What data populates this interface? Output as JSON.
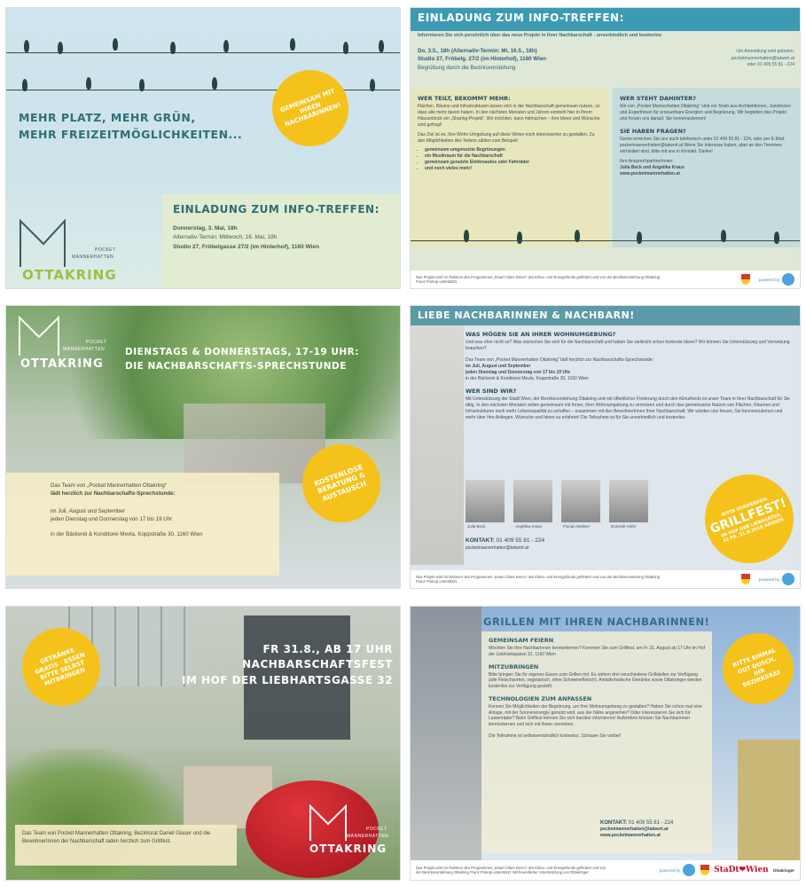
{
  "panel1": {
    "headline_1": "MEHR PLATZ, MEHR GRÜN,",
    "headline_2": "MEHR FREIZEITMÖGLICHKEITEN...",
    "badge": "GEMEINSAM MIT IHREN NACHBARINNEN!",
    "invite_title": "EINLADUNG ZUM INFO-TREFFEN:",
    "line_1": "Donnerstag, 3. Mai, 18h",
    "line_2": "Alternativ-Termin: Mittwoch, 16. Mai, 18h",
    "line_3": "Studio 27, Fröbelgasse 27/2 (im Hinterhof), 1160 Wien",
    "logo_pocket": "POCKET",
    "logo_mannerhatten": "MANNERHATTEN",
    "logo_ottakring": "OTTAKRING"
  },
  "panel2": {
    "title": "EINLADUNG ZUM INFO-TREFFEN:",
    "subtitle": "Informieren Sie sich persönlich über das neue Projekt in Ihrer Nachbarschaft - unverbindlich und kostenlos",
    "date": "Do, 3.5., 18h (Alternativ-Termin: Mi, 16.5., 18h)",
    "place": "Studio 27, Fröbelg. 27/2 (im Hinterhof), 1160 Wien",
    "greeting": "Begrüßung durch die Bezirksvorstehung",
    "contact_right_1": "Um Anmeldung wird gebeten:",
    "contact_right_2": "pocketmannerhatten@tatwort.at",
    "contact_right_3": "oder 01 409 55 81 - 224",
    "col1_title": "WER TEILT, BEKOMMT MEHR:",
    "col1_body": "Flächen, Räume und Infrastrukturen lassen sich in der Nachbarschaft gemeinsam nutzen, so dass alle mehr davon haben. In den nächsten Monaten und Jahren entsteht hier in Ihrem Häuserblock ein „Sharing-Projekt“. Wir möchten, kann mitmachen – Ihre Ideen und Wünsche sind gefragt!",
    "col1_body_2": "Das Ziel ist es, Ihre Wohn-Umgebung auf diese Weise noch lebenswerter zu gestalten. Zu den Möglichkeiten des Teilens zählen zum Beispiel:",
    "col1_list": [
      "gemeinsam umgenutzte Begrünungen",
      "ein Musikraum für die Nachbarschaft",
      "gemeinsam genutzte Elektroautos oder Fahrräder",
      "und noch vieles mehr!"
    ],
    "col2_title": "WER STEHT DAHINTER?",
    "col2_body": "Wir von „Pocket Mannerhatten Ottakring“ sind ein Team aus ArchitektInnen, JuristInnen und ExpertInnen für erneuerbare Energien und Begrünung. Wir begleiten das Projekt und freuen uns darauf, Sie kennenzulernen!",
    "col3_title": "SIE HABEN FRAGEN?",
    "col3_body": "Gerne erreichen Sie uns auch telefonisch unter 01 409 55 81 - 224, oder per E-Mail: pocketmannerhatten@tatwort.at Wenn Sie Interesse haben, aber an den Terminen verhindert sind, bitte mit uns in Kontakt. Danke!",
    "col3_contact_1": "Ihre AnsprechpartnerInnen:",
    "col3_contact_2": "Julia Beck und Angelika Kraus",
    "col3_contact_3": "www.pocketmannerhatten.at",
    "footer": "Das Projekt wird im Rahmen des Programmes „Smart Cities Demo“ des Klima- und Energiefonds gefördert und von der Bezirksvorstehung Ottakring Franz Prokop unterstützt.",
    "powered": "powered by"
  },
  "panel3": {
    "headline_1": "DIENSTAGS & DONNERSTAGS, 17-19 UHR:",
    "headline_2": "DIE NACHBARSCHAFTS-SPRECHSTUNDE",
    "badge": "KOSTENLOSE BERATUNG & AUSTAUSCH",
    "body_1": "Das Team von „Pocket Mannerhatten Ottakring“",
    "body_2": "lädt herzlich zur Nachbarschafts-Sprechstunde:",
    "body_3": "im Juli, August und September",
    "body_4": "jeden Dienstag und Donnerstag von 17 bis 19 Uhr",
    "body_5": "in der Bäckerei & Konditorei Mevla, Koppstraße 30, 1160 Wien",
    "logo_pocket": "POCKET",
    "logo_mannerhatten": "MANNERHATTEN",
    "logo_ottakring": "OTTAKRING"
  },
  "panel4": {
    "title": "LIEBE NACHBARINNEN & NACHBARN!",
    "q1": "WAS MÖGEN SIE AN IHRER WOHNUMGEBUNG?",
    "q1_body": "Und was eher nicht so? Was wünschen Sie sich für die Nachbarschaft und haben Sie vielleicht schon konkrete Ideen? Wir können Sie Unterstützung und Vernetzung brauchen?",
    "mid_1": "Das Team von „Pocket Mannerhatten Ottakring“ lädt herzlich zur Nachbarschafts-Sprechstunde:",
    "mid_2": "im Juli, August und September",
    "mid_3": "jeden Dienstag und Donnerstag von 17 bis 19 Uhr",
    "mid_4": "in der Bäckerei & Konditorei Mevla, Koppstraße 30, 1160 Wien",
    "q2": "WER SIND WIR?",
    "q2_body": "Mit Unterstützung der Stadt Wien, der Bezirksvorstehung Ottakring und mit öffentlicher Förderung durch den Klimafonds ist unser Team in Ihrer Nachbarschaft für Sie tätig. In den nächsten Monaten sollen gemeinsam mit Ihnen, Ihrer Wohnumgebung zu vernetzen und durch das gemeinsame Nutzen von Flächen, Räumen und Infrastrukturen noch mehr Lebensqualität zu schaffen – zusammen mit den BewohnerInnen Ihrer Nachbarschaft. Wir würden uns freuen, Sie kennenzulernen und mehr über Ihre Anliegen, Wünsche und Ideen zu erfahren! Die Teilnahme ist für Sie unverbindlich und kostenlos.",
    "names": [
      "Julia Beck",
      "Angelika Kraus",
      "Florian Wallner",
      "Dominik Hofer"
    ],
    "kontakt_label": "KONTAKT:",
    "kontakt_phone": "01 409 55 81 - 224",
    "kontakt_mail": "pocketmannerhatten@tatwort.at",
    "badge_top": "BITTE VORMERKEN:",
    "badge_main": "GRILLFEST!",
    "badge_bottom": "IM HOF DER LIEBHARTSG. 32 FR. 31.8.2018 ABENDS",
    "footer": "Das Projekt wird im Rahmen des Programmes „Smart Cities Demo“ des Klima- und Energiefonds gefördert und von der Bezirksvorstehung Ottakring Franz Prokop unterstützt.",
    "powered": "powered by"
  },
  "panel5": {
    "headline_1": "FR 31.8., AB 17 UHR",
    "headline_2": "NACHBARSCHAFTSFEST",
    "headline_3": "IM HOF DER LIEBHARTSGASSE 32",
    "badge": "GETRÄNKE GRATIS · ESSEN BITTE SELBST MITBRINGEN",
    "body": "Das Team von Pocket Mannerhatten Ottakring, Bezirksrat Daniel Glaser und die BewohnerInnen der Nachbarschaft laden herzlich zum Grillfest.",
    "logo_pocket": "POCKET",
    "logo_mannerhatten": "MANNERHATTEN",
    "logo_ottakring": "OTTAKRING"
  },
  "panel6": {
    "title": "GRILLEN MIT IHREN NACHBARINNEN!",
    "s1_title": "GEMEINSAM FEIERN",
    "s1_body": "Möchten Sie Ihre Nachbarinnen kennenlernen? Kommen Sie zum Grillfest, am Fr 31. August ab 17 Uhr im Hof der Liebhartsgasse 32, 1160 Wien",
    "s2_title": "MITZUBRINGEN",
    "s2_body": "Bitte bringen Sie Ihr eigenes Essen zum Grillen mit. Es stehen drei verschiedene Grillstellen zur Verfügung (alle Fleischsorten, vegetarisch, ohne Schweinefleisch). Antialkoholische Getränke sowie Ottakringer werden kostenlos zur Verfügung gestellt.",
    "s3_title": "TECHNOLOGIEN ZUM ANFASSEN",
    "s3_body": "Kennen Sie Möglichkeiten der Begrünung, um Ihre Wohnumgebung zu gestalten? Haben Sie schon mal eine Anlage, mit der Sonnenenergie genutzt wird, aus der Nähe angesehen? Oder interessieren Sie sich für Lastenräder? Beim Grillfest können Sie sich darüber informieren! Außerdem können Sie Nachbarinnen kennenlernen und sich mit ihnen vernetzen.",
    "s4_body": "Die Teilnahme ist selbstverständlich kostenlos. Schauen Sie vorbei!",
    "kontakt_label": "KONTAKT:",
    "kontakt_phone": "01 409 55 81 - 224",
    "kontakt_mail": "pocketmannerhatten@tatwort.at",
    "kontakt_web": "www.pocketmannerhatten.at",
    "badge": "BITTE EINMAL GUT DUSCH. IHR BEZIRKSRAT",
    "footer": "Das Projekt wird im Rahmen des Programmes „Smart Cities Demo“ des Klima- und Energiefonds gefördert und von der Bezirksvorstehung Ottakring Franz Prokop unterstützt. Mit freundlicher Unterstützung von Ottakringer.",
    "powered": "powered by",
    "stadt": "StaDt❤Wien",
    "ottakringer": "Ottakringer"
  }
}
